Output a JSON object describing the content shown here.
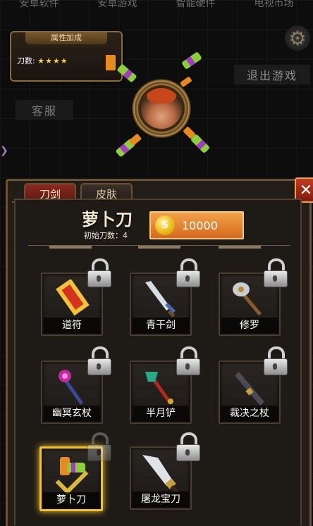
{
  "top_nav": [
    "安卓软件",
    "安卓游戏",
    "智能硬件",
    "电视市场"
  ],
  "attr_panel": {
    "title": "属性加成",
    "label": "刀数:",
    "stars": "★★★★"
  },
  "exit_button": "退出游戏",
  "service_button": "客服",
  "tabs": [
    "刀剑",
    "皮肤"
  ],
  "close_label": "✕",
  "selected": {
    "name": "萝卜刀",
    "initial_count": "初始刀数：4",
    "price": "10000",
    "coin_symbol": "S"
  },
  "weapons": [
    {
      "label": "道符",
      "locked": true
    },
    {
      "label": "青干剑",
      "locked": true
    },
    {
      "label": "修罗",
      "locked": true
    },
    {
      "label": "幽冥玄杖",
      "locked": true
    },
    {
      "label": "半月铲",
      "locked": true
    },
    {
      "label": "裁决之杖",
      "locked": true
    },
    {
      "label": "萝卜刀",
      "locked": false,
      "selected": true
    },
    {
      "label": "屠龙宝刀",
      "locked": true
    }
  ],
  "colors": {
    "accent_gold": "#f2c230",
    "price_orange": "#e07f2a",
    "tab_red": "#8a2a1e"
  }
}
